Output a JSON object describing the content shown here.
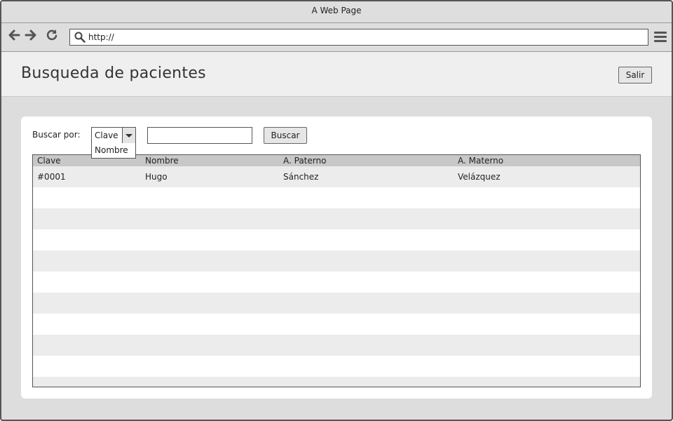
{
  "window": {
    "title": "A Web Page"
  },
  "browser": {
    "url": "http://"
  },
  "header": {
    "title": "Busqueda de pacientes",
    "logout_label": "Salir"
  },
  "search": {
    "label": "Buscar por:",
    "selected": "Clave",
    "options": [
      "Nombre"
    ],
    "query": "",
    "button_label": "Buscar"
  },
  "table": {
    "columns": [
      "Clave",
      "Nombre",
      "A. Paterno",
      "A. Materno"
    ],
    "rows": [
      [
        "#0001",
        "Hugo",
        "Sánchez",
        "Velázquez"
      ]
    ]
  },
  "icons": {
    "back": "arrow-left-icon",
    "forward": "arrow-right-icon",
    "reload": "reload-icon",
    "search": "search-icon",
    "menu": "hamburger-menu-icon",
    "dropdown": "chevron-down-icon"
  },
  "colors": {
    "chrome": "#dedede",
    "header_bg": "#efefef",
    "table_header": "#c8c8c8",
    "row_alt": "#ececec"
  }
}
